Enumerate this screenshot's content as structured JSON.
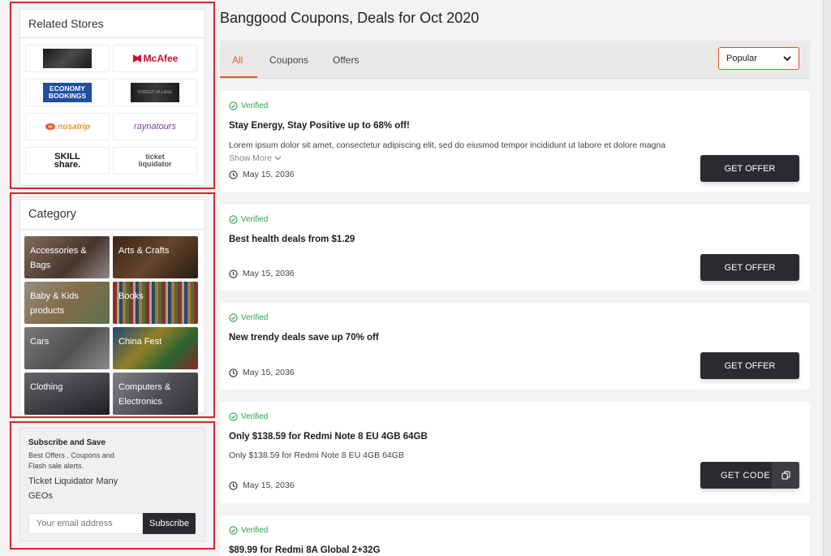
{
  "related_stores": {
    "title": "Related Stores",
    "stores": [
      {
        "name": "dark-banner-logo",
        "text": ""
      },
      {
        "name": "mcafee-logo",
        "text": "McAfee"
      },
      {
        "name": "economy-bookings-logo",
        "text": "ECONOMY BOOKINGS"
      },
      {
        "name": "forest-village-logo",
        "text": "FOREST VILLAGE"
      },
      {
        "name": "nusatrip-logo",
        "text": "nusatrip"
      },
      {
        "name": "raynatours-logo",
        "text": "raynatours"
      },
      {
        "name": "skillshare-logo",
        "text": "SKILL share."
      },
      {
        "name": "ticket-liquidator-logo",
        "text": "ticket liquidator"
      }
    ]
  },
  "category": {
    "title": "Category",
    "items": [
      {
        "label": "Accessories & Bags",
        "color": "#8a6d5c"
      },
      {
        "label": "Arts & Crafts",
        "color": "#7a5438"
      },
      {
        "label": "Baby & Kids products",
        "color": "#b8a07a"
      },
      {
        "label": "Books",
        "color": "#a86a4c"
      },
      {
        "label": "Cars",
        "color": "#8c8d90"
      },
      {
        "label": "China Fest",
        "color": "#4c6f8c"
      },
      {
        "label": "Clothing",
        "color": "#6b6e73"
      },
      {
        "label": "Computers & Electronics",
        "color": "#85878c"
      }
    ]
  },
  "subscribe": {
    "title": "Subscribe and Save",
    "line1": "Best Offers , Coupons and",
    "line2": "Flash sale alerts.",
    "line3": "Ticket Liquidator Many",
    "line4": "GEOs",
    "placeholder": "Your email address",
    "button": "Subscribe"
  },
  "main": {
    "heading": "Banggood Coupons, Deals for Oct 2020",
    "tabs": [
      "All",
      "Coupons",
      "Offers"
    ],
    "sort": {
      "selected": "Popular"
    },
    "offers": [
      {
        "verified": "Verified",
        "title": "Stay Energy, Stay Positive up to 68% off!",
        "desc": "Lorem ipsum dolor sit amet, consectetur adipiscing elit, sed do eiusmod tempor incididunt ut labore et dolore magna",
        "more": "Show More",
        "date": "May 15, 2036",
        "button": "GET OFFER"
      },
      {
        "verified": "Verified",
        "title": "Best health deals from $1.29",
        "date": "May 15, 2036",
        "button": "GET OFFER"
      },
      {
        "verified": "Verified",
        "title": "New trendy deals save up 70% off",
        "date": "May 15, 2036",
        "button": "GET OFFER"
      },
      {
        "verified": "Verified",
        "title": "Only $138.59 for Redmi Note 8 EU 4GB 64GB",
        "desc": "Only $138.59 for Redmi Note 8 EU 4GB 64GB",
        "date": "May 15, 2036",
        "button": "GET CODE"
      },
      {
        "verified": "Verified",
        "title": "$89.99 for Redmi 8A Global 2+32G"
      }
    ]
  },
  "colors": {
    "accent": "#e4572e",
    "verified": "#2e9e4a",
    "button": "#2b2a30",
    "highlight": "#d9252b"
  }
}
